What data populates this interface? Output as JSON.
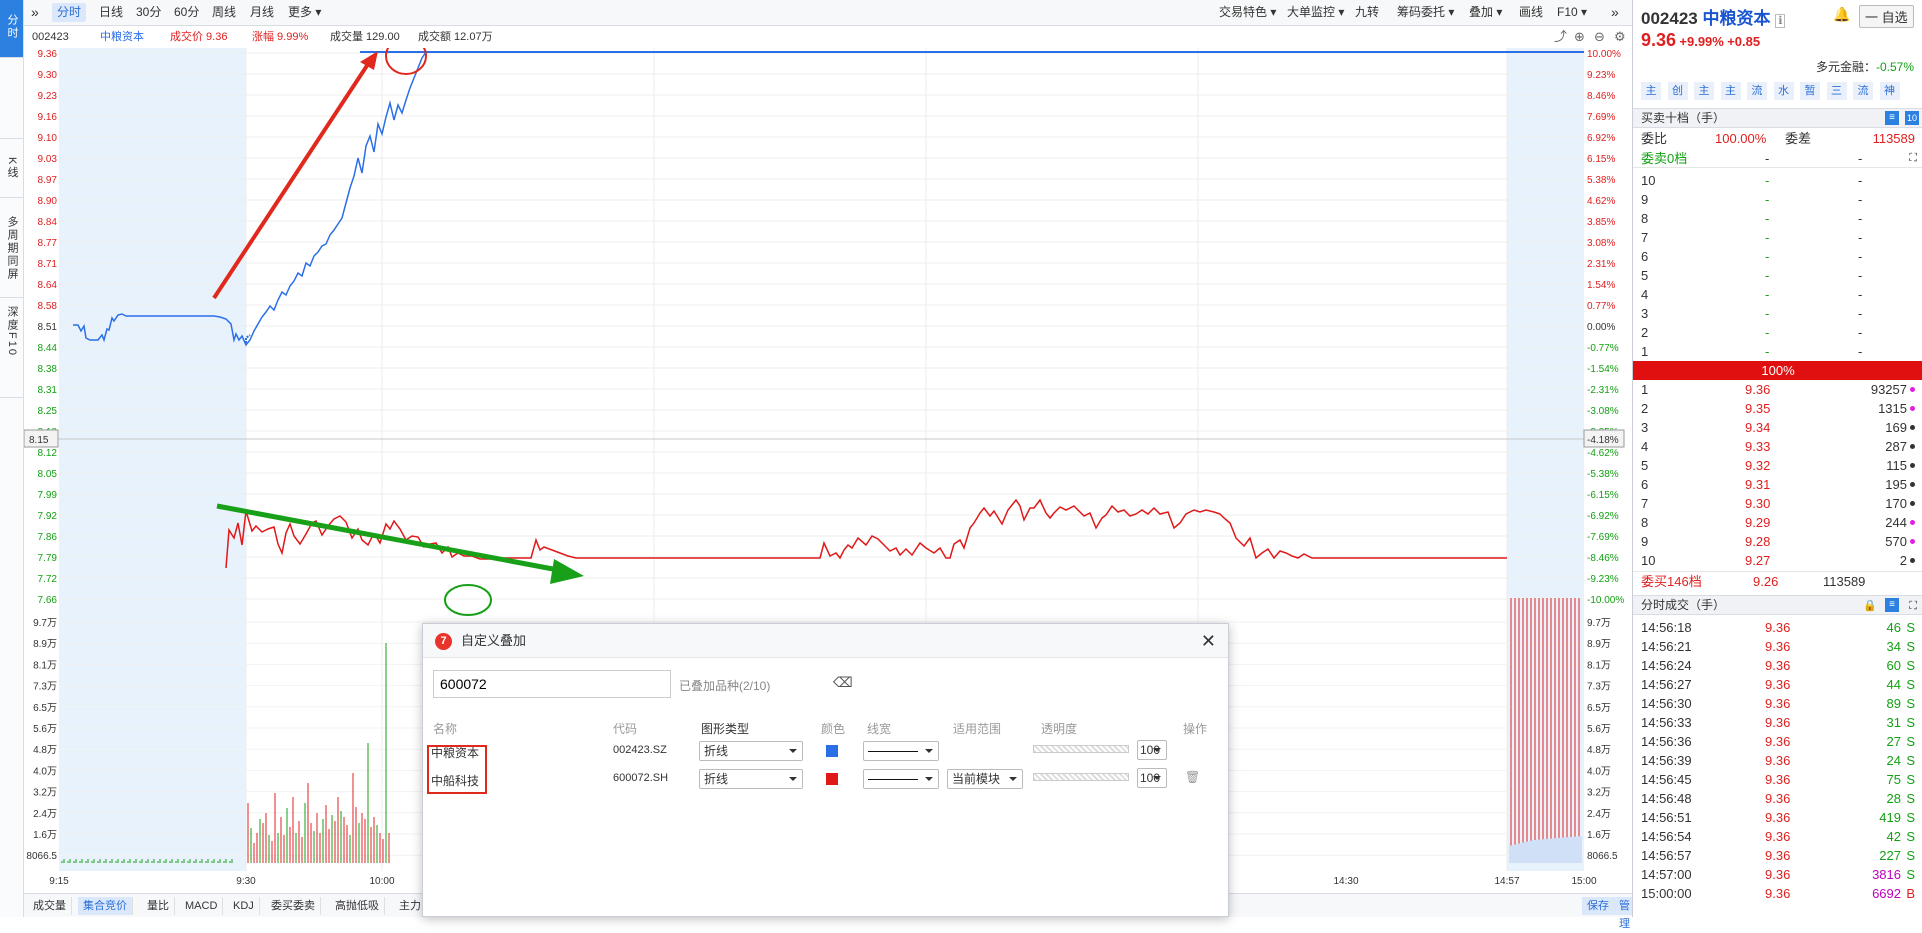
{
  "left_sidebar": {
    "tabs": [
      {
        "label": "分时"
      },
      {
        "label": "K线"
      },
      {
        "label": "多周期同屏"
      },
      {
        "label": "深度F10"
      }
    ]
  },
  "topbar": {
    "collapse_glyph": "»",
    "period_tabs": [
      "分时",
      "日线",
      "30分",
      "60分",
      "周线",
      "月线",
      "更多"
    ],
    "tools": [
      "交易特色",
      "大单监控",
      "九转",
      "筹码委托",
      "叠加",
      "画线",
      "F10"
    ],
    "more_glyph": "»"
  },
  "info": {
    "code": "002423",
    "name": "中粮资本",
    "price": "成交价 9.36",
    "change": "涨幅 9.99%",
    "volume": "成交量 129.00",
    "amount": "成交额 12.07万"
  },
  "chart": {
    "price_axis_left": [
      "9.36",
      "9.30",
      "9.23",
      "9.16",
      "9.10",
      "9.03",
      "8.97",
      "8.90",
      "8.84",
      "8.77",
      "8.71",
      "8.64",
      "8.58",
      "8.51",
      "8.44",
      "8.38",
      "8.31",
      "8.25",
      "8.18",
      "8.15",
      "8.12",
      "8.05",
      "7.99",
      "7.92",
      "7.86",
      "7.79",
      "7.72",
      "7.66"
    ],
    "pct_axis_right": [
      "10.00%",
      "9.23%",
      "8.46%",
      "7.69%",
      "6.92%",
      "6.15%",
      "5.38%",
      "4.62%",
      "3.85%",
      "3.08%",
      "2.31%",
      "1.54%",
      "0.77%",
      "0.00%",
      "-0.77%",
      "-1.54%",
      "-2.31%",
      "-3.08%",
      "-3.85%",
      "-4.18%",
      "-4.62%",
      "-5.38%",
      "-6.15%",
      "-6.92%",
      "-7.69%",
      "-8.46%",
      "-9.23%",
      "-10.00%"
    ],
    "vol_axis_left": [
      "9.7万",
      "8.9万",
      "8.1万",
      "7.3万",
      "6.5万",
      "5.6万",
      "4.8万",
      "4.0万",
      "3.2万",
      "2.4万",
      "1.6万",
      "8066.5"
    ],
    "vol_axis_right": [
      "9.7万",
      "8.9万",
      "8.1万",
      "7.3万",
      "6.5万",
      "5.6万",
      "4.8万",
      "4.0万",
      "3.2万",
      "2.4万",
      "1.6万",
      "8066.5"
    ],
    "time_axis": [
      "9:15",
      "9:30",
      "10:00",
      "14:30",
      "14:57",
      "15:00"
    ],
    "crosshair_left": "8.15",
    "crosshair_right": "-4.18%"
  },
  "bottom_tabs": {
    "tabs": [
      "成交量",
      "集合竞价",
      "量比",
      "MACD",
      "KDJ",
      "委买委卖",
      "高抛低吸",
      "主力"
    ],
    "save": "保存",
    "manage": "管理"
  },
  "right_panel": {
    "code": "002423",
    "name": "中粮资本",
    "info_glyph": "ℹ",
    "price": "9.36",
    "change_pct": "+9.99%",
    "change": "+0.85",
    "watch_btn": "一 自选",
    "sector": "多元金融",
    "sector_pct": "-0.57%",
    "chips": [
      "主",
      "创",
      "主",
      "主",
      "流",
      "水",
      "暂",
      "三",
      "流",
      "神"
    ],
    "book_title": "买卖十档（手）",
    "ratio_label": "委比",
    "ratio_value": "100.00%",
    "diff_label": "委差",
    "diff_value": "113589",
    "sell_total": "委卖0档",
    "dash": "-",
    "sells": [
      "10",
      "9",
      "8",
      "7",
      "6",
      "5",
      "4",
      "3",
      "2",
      "1"
    ],
    "bar_label": "100%",
    "buys": [
      {
        "lv": "1",
        "p": "9.36",
        "v": "93257"
      },
      {
        "lv": "2",
        "p": "9.35",
        "v": "1315"
      },
      {
        "lv": "3",
        "p": "9.34",
        "v": "169"
      },
      {
        "lv": "4",
        "p": "9.33",
        "v": "287"
      },
      {
        "lv": "5",
        "p": "9.32",
        "v": "115"
      },
      {
        "lv": "6",
        "p": "9.31",
        "v": "195"
      },
      {
        "lv": "7",
        "p": "9.30",
        "v": "170"
      },
      {
        "lv": "8",
        "p": "9.29",
        "v": "244"
      },
      {
        "lv": "9",
        "p": "9.28",
        "v": "570"
      },
      {
        "lv": "10",
        "p": "9.27",
        "v": "2"
      }
    ],
    "buy_total_label": "委买146档",
    "buy_total_price": "9.26",
    "buy_total_vol": "113589",
    "ticks_title": "分时成交（手）",
    "ticks": [
      {
        "t": "14:56:18",
        "p": "9.36",
        "v": "46",
        "s": "S"
      },
      {
        "t": "14:56:21",
        "p": "9.36",
        "v": "34",
        "s": "S"
      },
      {
        "t": "14:56:24",
        "p": "9.36",
        "v": "60",
        "s": "S"
      },
      {
        "t": "14:56:27",
        "p": "9.36",
        "v": "44",
        "s": "S"
      },
      {
        "t": "14:56:30",
        "p": "9.36",
        "v": "89",
        "s": "S"
      },
      {
        "t": "14:56:33",
        "p": "9.36",
        "v": "31",
        "s": "S"
      },
      {
        "t": "14:56:36",
        "p": "9.36",
        "v": "27",
        "s": "S"
      },
      {
        "t": "14:56:39",
        "p": "9.36",
        "v": "24",
        "s": "S"
      },
      {
        "t": "14:56:45",
        "p": "9.36",
        "v": "75",
        "s": "S"
      },
      {
        "t": "14:56:48",
        "p": "9.36",
        "v": "28",
        "s": "S"
      },
      {
        "t": "14:56:51",
        "p": "9.36",
        "v": "419",
        "s": "S"
      },
      {
        "t": "14:56:54",
        "p": "9.36",
        "v": "42",
        "s": "S"
      },
      {
        "t": "14:56:57",
        "p": "9.36",
        "v": "227",
        "s": "S"
      },
      {
        "t": "14:57:00",
        "p": "9.36",
        "v": "3816",
        "s": "S"
      },
      {
        "t": "15:00:00",
        "p": "9.36",
        "v": "6692",
        "s": "B"
      }
    ]
  },
  "dialog": {
    "title": "自定义叠加",
    "input_value": "600072",
    "added": "已叠加品种(2/10)",
    "headers": [
      "名称",
      "代码",
      "图形类型",
      "颜色",
      "线宽",
      "适用范围",
      "透明度",
      "操作"
    ],
    "rows": [
      {
        "name": "中粮资本",
        "code": "002423.SZ",
        "type": "折线",
        "color": "#2b6fe8",
        "opacity": "100"
      },
      {
        "name": "中船科技",
        "code": "600072.SH",
        "type": "折线",
        "color": "#e01818",
        "scope": "当前模块",
        "opacity": "100"
      }
    ]
  },
  "colors": {
    "accent": "#2b80e0",
    "up": "#e02020",
    "down": "#14a014",
    "line1": "#2b6fe8",
    "line2": "#e01818"
  }
}
